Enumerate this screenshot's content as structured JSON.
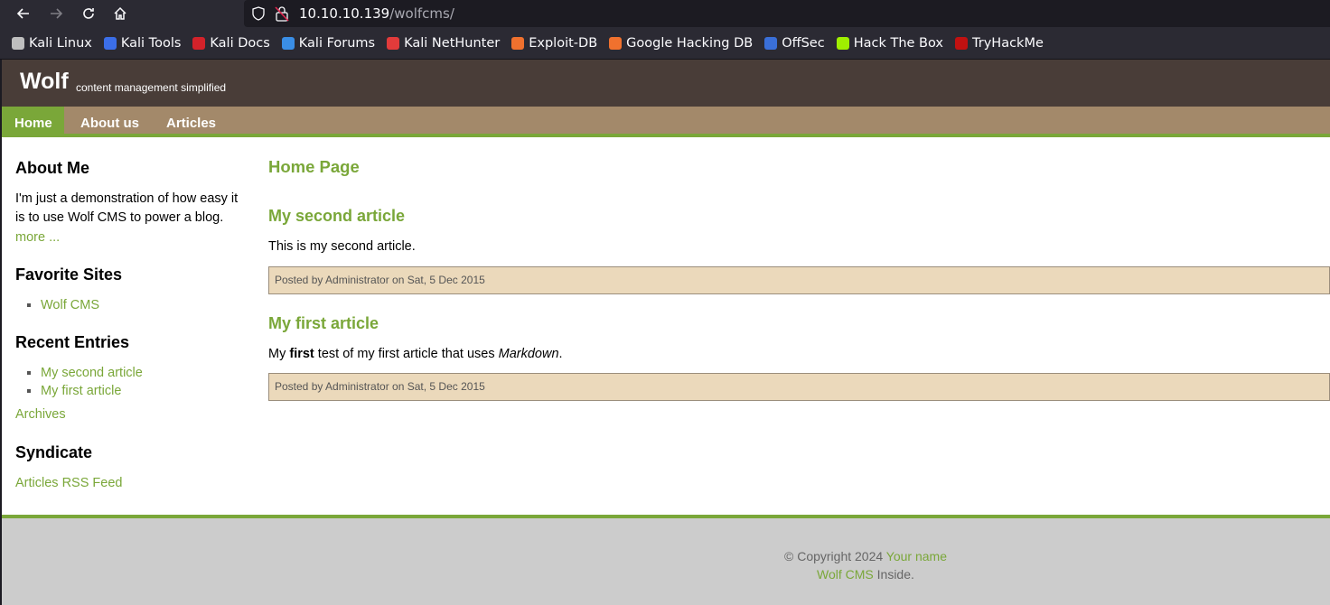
{
  "browser": {
    "url_host": "10.10.10.139",
    "url_path": "/wolfcms/",
    "bookmarks": [
      {
        "label": "Kali Linux",
        "icon": "kali-dragon-icon",
        "color": "#bfbfbf"
      },
      {
        "label": "Kali Tools",
        "icon": "kali-tools-icon",
        "color": "#3b6ee8"
      },
      {
        "label": "Kali Docs",
        "icon": "kali-docs-icon",
        "color": "#d3222a"
      },
      {
        "label": "Kali Forums",
        "icon": "kali-forums-icon",
        "color": "#3a8ee6"
      },
      {
        "label": "Kali NetHunter",
        "icon": "nethunter-icon",
        "color": "#e23b3b"
      },
      {
        "label": "Exploit-DB",
        "icon": "exploit-db-icon",
        "color": "#f0712e"
      },
      {
        "label": "Google Hacking DB",
        "icon": "ghdb-icon",
        "color": "#f0712e"
      },
      {
        "label": "OffSec",
        "icon": "offsec-icon",
        "color": "#3a6fd8"
      },
      {
        "label": "Hack The Box",
        "icon": "htb-cube-icon",
        "color": "#9fef00"
      },
      {
        "label": "TryHackMe",
        "icon": "thm-cloud-icon",
        "color": "#c11111"
      }
    ]
  },
  "site": {
    "title": "Wolf",
    "slogan": "content management simplified",
    "menu": [
      "Home",
      "About us",
      "Articles"
    ]
  },
  "sidebar": {
    "about_heading": "About Me",
    "about_text": "I'm just a demonstration of how easy it is to use Wolf CMS to power a blog.",
    "about_more": "more ...",
    "favorites_heading": "Favorite Sites",
    "favorites": [
      "Wolf CMS"
    ],
    "recent_heading": "Recent Entries",
    "recent": [
      "My second article",
      "My first article"
    ],
    "archives": "Archives",
    "syndicate_heading": "Syndicate",
    "rss": "Articles RSS Feed"
  },
  "content": {
    "page_title": "Home Page",
    "articles": [
      {
        "title": "My second article",
        "body": "This is my second article.",
        "meta": "Posted by Administrator on Sat, 5 Dec 2015"
      },
      {
        "title": "My first article",
        "body_pre": "My ",
        "body_bold": "first",
        "body_mid": " test of my first article that uses ",
        "body_em": "Markdown",
        "body_post": ".",
        "meta": "Posted by Administrator on Sat, 5 Dec 2015"
      }
    ]
  },
  "footer": {
    "copyright": "© Copyright 2024 ",
    "your_name": "Your name",
    "wolf_cms": "Wolf CMS",
    "inside": " Inside."
  },
  "colors": {
    "accent_green": "#7aa739",
    "header_brown": "#493d38",
    "menu_tan": "#a3896a",
    "meta_bg": "#ebd9bb"
  }
}
